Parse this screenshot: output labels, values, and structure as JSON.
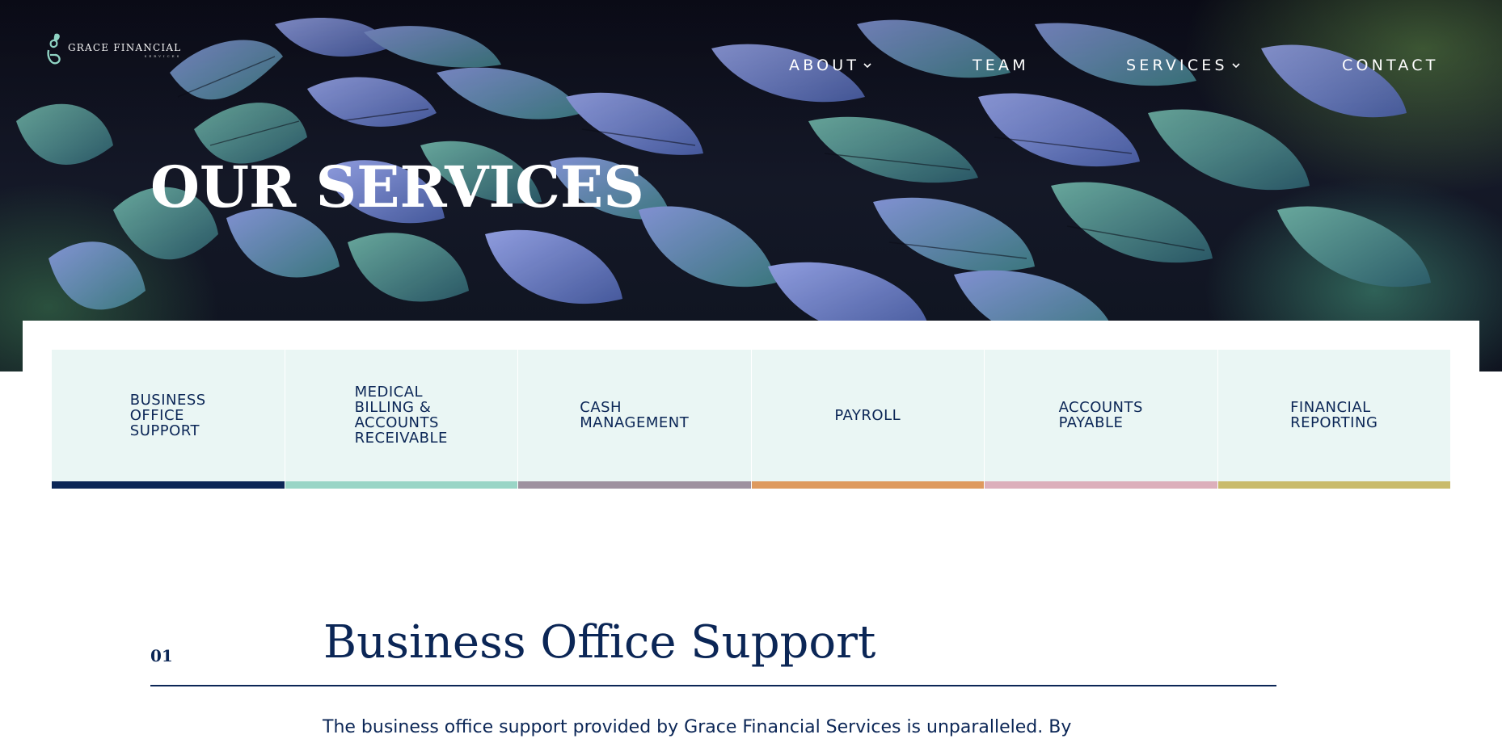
{
  "header": {
    "logo": {
      "name": "GRACE FINANCIAL",
      "subtitle": "SERVICES"
    },
    "nav": [
      {
        "label": "ABOUT",
        "has_dropdown": true
      },
      {
        "label": "TEAM",
        "has_dropdown": false
      },
      {
        "label": "SERVICES",
        "has_dropdown": true
      },
      {
        "label": "CONTACT",
        "has_dropdown": false
      }
    ]
  },
  "hero": {
    "title": "OUR SERVICES"
  },
  "service_tabs": [
    {
      "label": "BUSINESS\nOFFICE\nSUPPORT",
      "accent": "#0b2656"
    },
    {
      "label": "MEDICAL\nBILLING &\nACCOUNTS\nRECEIVABLE",
      "accent": "#99d5c6"
    },
    {
      "label": "CASH\nMANAGEMENT",
      "accent": "#9e919f"
    },
    {
      "label": "PAYROLL",
      "accent": "#de9a5e"
    },
    {
      "label": "ACCOUNTS\nPAYABLE",
      "accent": "#dcafbb"
    },
    {
      "label": "FINANCIAL\nREPORTING",
      "accent": "#c9bb6c"
    }
  ],
  "section": {
    "number": "01",
    "title": "Business Office Support",
    "body": "The business office support provided by Grace Financial Services is unparalleled. By"
  },
  "colors": {
    "navy": "#0b2656",
    "tab_bg": "#eaf6f4",
    "logo_mark": "#8fd3c3"
  },
  "icons": {
    "logo_mark": "leaf-g-logo-icon",
    "dropdown": "chevron-down-icon"
  }
}
